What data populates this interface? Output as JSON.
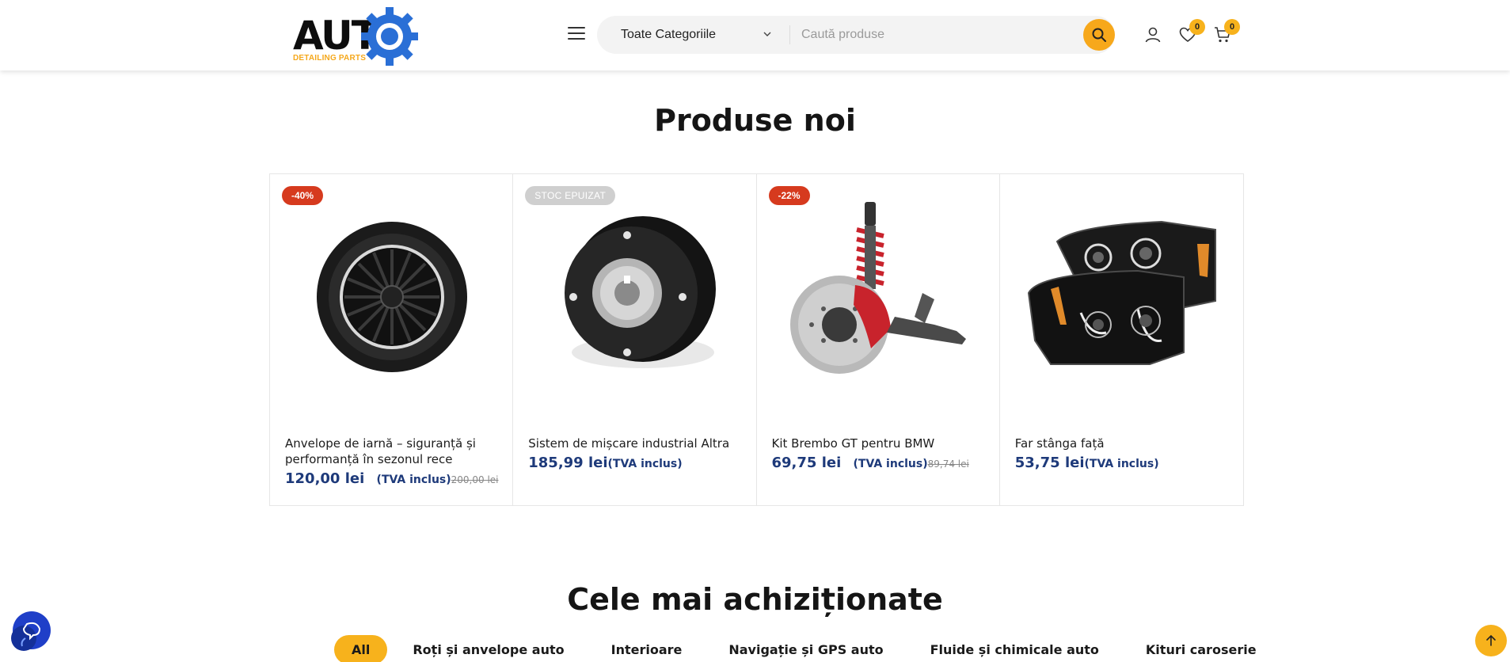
{
  "header": {
    "logo": {
      "text": "AUTO",
      "subtitle": "DETAILING PARTS"
    },
    "category_select": "Toate Categoriile",
    "search_placeholder": "Caută produse",
    "wishlist_count": "0",
    "cart_count": "0"
  },
  "new_products": {
    "title": "Produse noi",
    "items": [
      {
        "badge": "-40%",
        "badge_type": "sale",
        "image_icon": "tire-icon",
        "name": "Anvelope de iarnă – siguranță și performanță în sezonul rece",
        "price": "120,00 lei",
        "tva": "(TVA inclus)",
        "old_price": "200,00 lei"
      },
      {
        "badge": "STOC EPUIZAT",
        "badge_type": "out-of-stock",
        "image_icon": "brake-motor-icon",
        "name": "Sistem de mișcare industrial Altra",
        "price": "185,99 lei",
        "tva": "(TVA inclus)",
        "old_price": ""
      },
      {
        "badge": "-22%",
        "badge_type": "sale",
        "image_icon": "brake-kit-icon",
        "name": "Kit Brembo GT pentru BMW",
        "price": "69,75 lei",
        "tva": "(TVA inclus)",
        "old_price": "89,74 lei"
      },
      {
        "badge": "",
        "badge_type": "none",
        "image_icon": "headlight-icon",
        "name": "Far stânga față",
        "price": "53,75 lei",
        "tva": "(TVA inclus)",
        "old_price": ""
      }
    ]
  },
  "best_sellers": {
    "title": "Cele mai achiziționate",
    "tabs": [
      "All",
      "Roți și anvelope auto",
      "Interioare",
      "Navigație și GPS auto",
      "Fluide și chimicale auto",
      "Kituri caroserie"
    ],
    "active_tab": "All"
  },
  "colors": {
    "accent": "#f7b21c",
    "sale": "#d63a1e",
    "price": "#1e3a7a"
  }
}
